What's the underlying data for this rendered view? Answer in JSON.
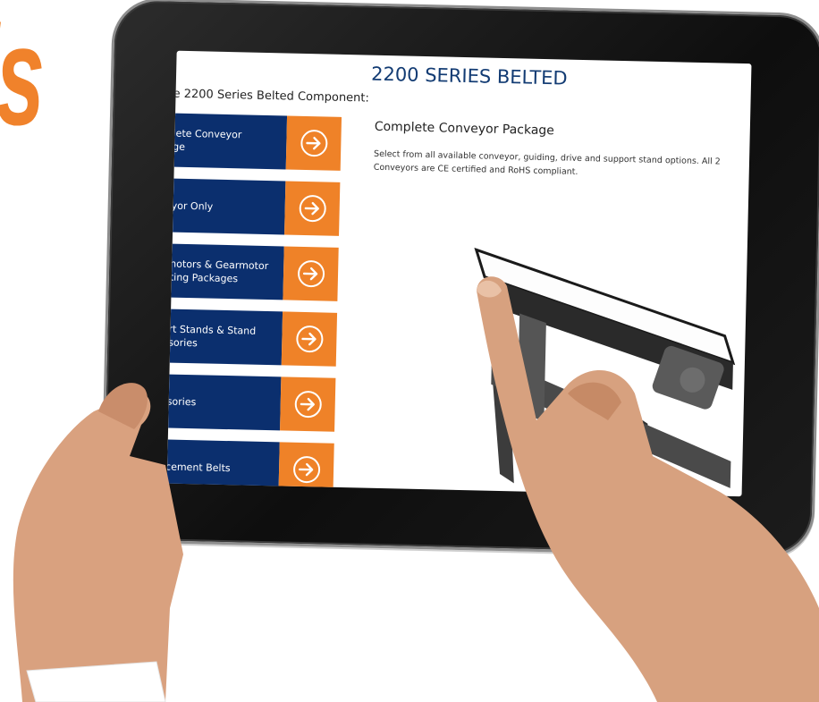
{
  "brand": {
    "partial_text": "ls",
    "color": "#f0822b"
  },
  "screen": {
    "title": "2200 SERIES BELTED",
    "subtitle": "e 2200 Series Belted Component:"
  },
  "menu": {
    "items": [
      {
        "label": "lete Conveyor\nge"
      },
      {
        "label": "yor Only"
      },
      {
        "label": "notors & Gearmotor\nting Packages"
      },
      {
        "label": "rt Stands & Stand\nsories"
      },
      {
        "label": "sories"
      },
      {
        "label": "cement Belts"
      }
    ],
    "arrow_icon": "arrow-right-circle-icon",
    "label_bg": "#0b2f6e",
    "arrow_bg": "#ef8228"
  },
  "content": {
    "heading": "Complete Conveyor Package",
    "description": "Select from all available conveyor, guiding, drive and support stand options. All 2 Conveyors are CE certified and RoHS compliant."
  }
}
